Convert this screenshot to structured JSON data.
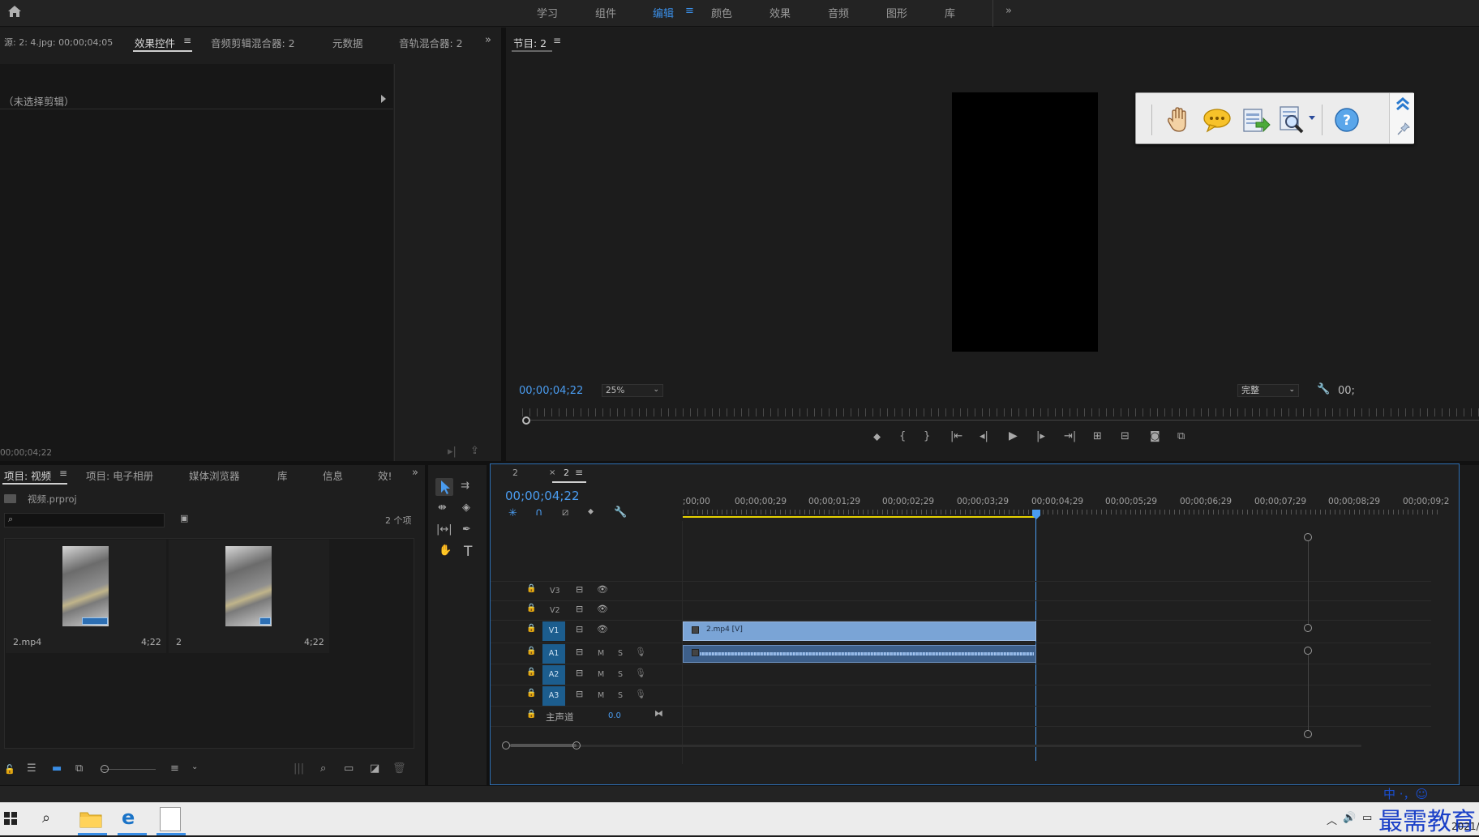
{
  "workspaces": {
    "items": [
      "学习",
      "组件",
      "编辑",
      "颜色",
      "效果",
      "音频",
      "图形",
      "库"
    ],
    "active": "编辑",
    "more": "»"
  },
  "source": {
    "tabs": [
      "源: 2: 4.jpg: 00;00;04;05",
      "效果控件",
      "音频剪辑混合器: 2",
      "元数据",
      "音轨混合器: 2"
    ],
    "no_clip": "（未选择剪辑）",
    "timecode": "00;00;04;22",
    "more": "»"
  },
  "program": {
    "title": "节目: 2",
    "timecode": "00;00;04;22",
    "zoom": "25%",
    "quality": "完整",
    "tc_right": "00;"
  },
  "floating_toolbar": {
    "tools": [
      "hand",
      "comment",
      "export",
      "zoom",
      "help"
    ]
  },
  "project": {
    "tabs": [
      "项目: 视频",
      "项目: 电子相册",
      "媒体浏览器",
      "库",
      "信息",
      "效!"
    ],
    "file": "视频.prproj",
    "count": "2 个项",
    "items": [
      {
        "name": "2.mp4",
        "dur": "4;22"
      },
      {
        "name": "2",
        "dur": "4;22"
      }
    ],
    "more": "»"
  },
  "timeline": {
    "tabs": [
      "2",
      "2"
    ],
    "timecode": "00;00;04;22",
    "ruler": [
      ";00;00",
      "00;00;00;29",
      "00;00;01;29",
      "00;00;02;29",
      "00;00;03;29",
      "00;00;04;29",
      "00;00;05;29",
      "00;00;06;29",
      "00;00;07;29",
      "00;00;08;29",
      "00;00;09;2"
    ],
    "tracks_v": [
      "V3",
      "V2",
      "V1"
    ],
    "tracks_a": [
      "A1",
      "A2",
      "A3"
    ],
    "master": "主声道",
    "master_val": "0.0",
    "clip_v": "2.mp4 [V]",
    "m": "M",
    "s": "S"
  },
  "taskbar": {
    "watermark": "最需教育",
    "year": "2021/",
    "tray": "中 ·，☺"
  }
}
